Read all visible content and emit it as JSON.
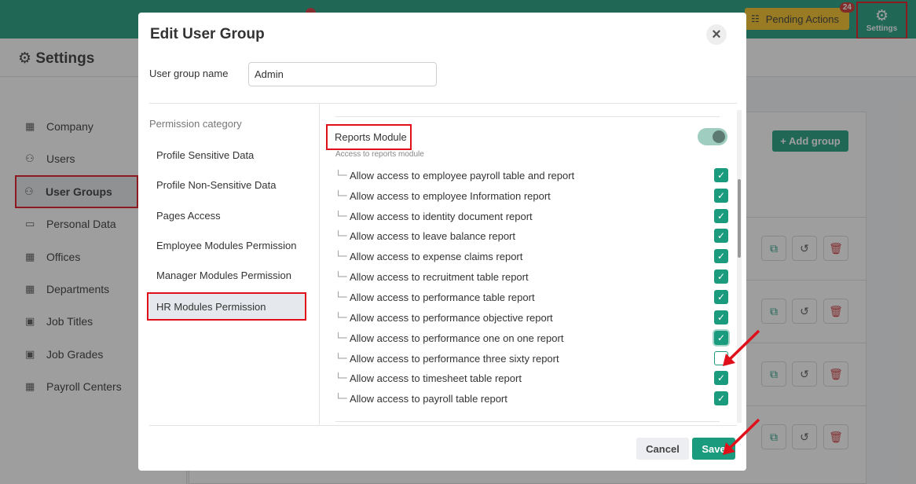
{
  "topbar": {
    "pending_label": "Pending Actions",
    "pending_count": "24",
    "settings_label": "Settings"
  },
  "page": {
    "title": "Settings"
  },
  "sidebar": {
    "items": [
      {
        "label": "Company",
        "icon": "building-icon"
      },
      {
        "label": "Users",
        "icon": "users-icon"
      },
      {
        "label": "User Groups",
        "icon": "users-icon"
      },
      {
        "label": "Personal Data",
        "icon": "id-card-icon"
      },
      {
        "label": "Offices",
        "icon": "building-icon"
      },
      {
        "label": "Departments",
        "icon": "building-icon"
      },
      {
        "label": "Job Titles",
        "icon": "briefcase-icon"
      },
      {
        "label": "Job Grades",
        "icon": "briefcase-icon"
      },
      {
        "label": "Payroll Centers",
        "icon": "building-icon"
      }
    ]
  },
  "main": {
    "add_group_label": "+ Add group"
  },
  "modal": {
    "title": "Edit User Group",
    "name_label": "User group name",
    "name_value": "Admin",
    "category_header": "Permission category",
    "categories": [
      "Profile Sensitive Data",
      "Profile Non-Sensitive Data",
      "Pages Access",
      "Employee Modules Permission",
      "Manager Modules Permission",
      "HR Modules Permission"
    ],
    "section": {
      "title": "Reports Module",
      "subtitle": "Access to reports module",
      "enabled": true
    },
    "permissions": [
      {
        "label": "Allow access to employee payroll table and report",
        "checked": true
      },
      {
        "label": "Allow access to employee Information report",
        "checked": true
      },
      {
        "label": "Allow access to identity document report",
        "checked": true
      },
      {
        "label": "Allow access to leave balance report",
        "checked": true
      },
      {
        "label": "Allow access to expense claims report",
        "checked": true
      },
      {
        "label": "Allow access to recruitment table report",
        "checked": true
      },
      {
        "label": "Allow access to performance table report",
        "checked": true
      },
      {
        "label": "Allow access to performance objective report",
        "checked": true
      },
      {
        "label": "Allow access to performance one on one report",
        "checked": true
      },
      {
        "label": "Allow access to performance three sixty report",
        "checked": false
      },
      {
        "label": "Allow access to timesheet table report",
        "checked": true
      },
      {
        "label": "Allow access to payroll table report",
        "checked": true
      }
    ],
    "cancel_label": "Cancel",
    "save_label": "Save"
  },
  "colors": {
    "brand": "#1b9b7d",
    "highlight": "#e0101b",
    "pending": "#f4c01f"
  }
}
